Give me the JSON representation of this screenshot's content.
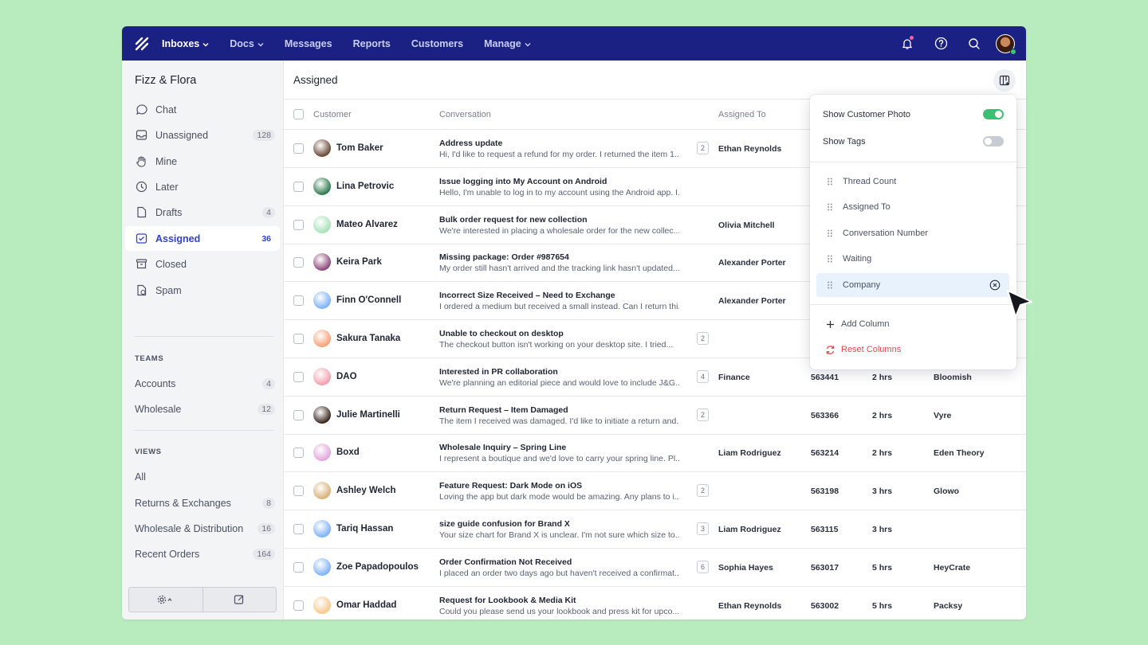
{
  "nav": {
    "items": [
      {
        "label": "Inboxes",
        "dropdown": true
      },
      {
        "label": "Docs",
        "dropdown": true
      },
      {
        "label": "Messages",
        "dropdown": false
      },
      {
        "label": "Reports",
        "dropdown": false
      },
      {
        "label": "Customers",
        "dropdown": false
      },
      {
        "label": "Manage",
        "dropdown": true
      }
    ]
  },
  "sidebar": {
    "brand": "Fizz & Flora",
    "mailboxes": [
      {
        "label": "Chat",
        "icon": "chat-bubble-icon",
        "count": ""
      },
      {
        "label": "Unassigned",
        "icon": "inbox-icon",
        "count": "128"
      },
      {
        "label": "Mine",
        "icon": "hand-icon",
        "count": ""
      },
      {
        "label": "Later",
        "icon": "clock-icon",
        "count": ""
      },
      {
        "label": "Drafts",
        "icon": "draft-icon",
        "count": "4"
      },
      {
        "label": "Assigned",
        "icon": "assigned-inbox-icon",
        "count": "36",
        "active": true
      },
      {
        "label": "Closed",
        "icon": "archive-icon",
        "count": ""
      },
      {
        "label": "Spam",
        "icon": "spam-icon",
        "count": ""
      }
    ],
    "teams_label": "TEAMS",
    "teams": [
      {
        "label": "Accounts",
        "count": "4"
      },
      {
        "label": "Wholesale",
        "count": "12"
      }
    ],
    "views_label": "VIEWS",
    "views": [
      {
        "label": "All",
        "count": ""
      },
      {
        "label": "Returns & Exchanges",
        "count": "8"
      },
      {
        "label": "Wholesale & Distribution",
        "count": "16"
      },
      {
        "label": "Recent Orders",
        "count": "164"
      }
    ]
  },
  "main": {
    "title": "Assigned",
    "columns": {
      "customer": "Customer",
      "conversation": "Conversation",
      "assigned_to": "Assigned To"
    },
    "rows": [
      {
        "customer": "Tom Baker",
        "avatar": "#6b4a3a",
        "subject": "Address update",
        "preview": "Hi, I'd like to request a refund for my order. I returned the item 1...",
        "threads": "2",
        "assigned": "Ethan Reynolds",
        "number": "",
        "waiting": "",
        "company": ""
      },
      {
        "customer": "Lina Petrovic",
        "avatar": "#2f7a52",
        "subject": "Issue logging into My Account on Android",
        "preview": "Hello, I'm unable to log in to my account using the Android app. I...",
        "threads": "",
        "assigned": "",
        "number": "",
        "waiting": "",
        "company": ""
      },
      {
        "customer": "Mateo Alvarez",
        "avatar": "#a7e2b8",
        "subject": "Bulk order request for new collection",
        "preview": "We're interested in placing a wholesale order for the new collec...",
        "threads": "",
        "assigned": "Olivia Mitchell",
        "number": "",
        "waiting": "",
        "company": ""
      },
      {
        "customer": "Keira Park",
        "avatar": "#8e4a7a",
        "subject": "Missing package: Order #987654",
        "preview": "My order still hasn't arrived and the tracking link hasn't updated...",
        "threads": "",
        "assigned": "Alexander Porter",
        "number": "",
        "waiting": "",
        "company": ""
      },
      {
        "customer": "Finn O'Connell",
        "avatar": "#7fb3f5",
        "subject": "Incorrect Size Received – Need to Exchange",
        "preview": "I ordered a medium but received a small instead. Can I return thi...",
        "threads": "",
        "assigned": "Alexander Porter",
        "number": "",
        "waiting": "",
        "company": ""
      },
      {
        "customer": "Sakura Tanaka",
        "avatar": "#f7a27a",
        "subject": "Unable to checkout on desktop",
        "preview": "The checkout button isn't working on your desktop site. I tried...",
        "threads": "2",
        "assigned": "",
        "number": "",
        "waiting": "",
        "company": ""
      },
      {
        "customer": "DAO",
        "avatar": "#f3a0b0",
        "subject": "Interested in PR collaboration",
        "preview": "We're planning an editorial piece and would love to include J&G...",
        "threads": "4",
        "assigned": "Finance",
        "number": "563441",
        "waiting": "2 hrs",
        "company": "Bloomish"
      },
      {
        "customer": "Julie Martinelli",
        "avatar": "#3b2a22",
        "subject": "Return Request – Item Damaged",
        "preview": "The item I received was damaged. I'd like to initiate a return and...",
        "threads": "2",
        "assigned": "",
        "number": "563366",
        "waiting": "2 hrs",
        "company": "Vyre"
      },
      {
        "customer": "Boxd",
        "avatar": "#e3a6dc",
        "subject": "Wholesale Inquiry – Spring Line",
        "preview": "I represent a boutique and we'd love to carry your spring line. Pl...",
        "threads": "",
        "assigned": "Liam Rodriguez",
        "number": "563214",
        "waiting": "2 hrs",
        "company": "Eden Theory"
      },
      {
        "customer": "Ashley Welch",
        "avatar": "#d8b27a",
        "subject": "Feature Request: Dark Mode on iOS",
        "preview": "Loving the app but dark mode would be amazing. Any plans to i...",
        "threads": "2",
        "assigned": "",
        "number": "563198",
        "waiting": "3 hrs",
        "company": "Glowo"
      },
      {
        "customer": "Tariq Hassan",
        "avatar": "#7fb3f5",
        "subject": "size guide confusion for Brand X",
        "preview": "Your size chart for Brand X is unclear. I'm not sure which size to...",
        "threads": "3",
        "assigned": "Liam Rodriguez",
        "number": "563115",
        "waiting": "3 hrs",
        "company": ""
      },
      {
        "customer": "Zoe Papadopoulos",
        "avatar": "#7fb3f5",
        "subject": "Order Confirmation Not Received",
        "preview": "I placed an order two days ago but haven't received a confirmat...",
        "threads": "6",
        "assigned": "Sophia Hayes",
        "number": "563017",
        "waiting": "5 hrs",
        "company": "HeyCrate"
      },
      {
        "customer": "Omar Haddad",
        "avatar": "#f7c98f",
        "subject": "Request for Lookbook & Media Kit",
        "preview": "Could you please send us your lookbook and press kit for upco...",
        "threads": "",
        "assigned": "Ethan Reynolds",
        "number": "563002",
        "waiting": "5 hrs",
        "company": "Packsy"
      }
    ]
  },
  "popover": {
    "show_photo_label": "Show Customer Photo",
    "show_photo": true,
    "show_tags_label": "Show Tags",
    "show_tags": false,
    "columns": [
      {
        "label": "Thread Count",
        "highlighted": false
      },
      {
        "label": "Assigned To",
        "highlighted": false
      },
      {
        "label": "Conversation Number",
        "highlighted": false
      },
      {
        "label": "Waiting",
        "highlighted": false
      },
      {
        "label": "Company",
        "highlighted": true
      }
    ],
    "add_column": "Add Column",
    "reset_columns": "Reset Columns"
  },
  "colors": {
    "topbar": "#1b2183",
    "accent": "#2e43c7",
    "toggle_on": "#3fbf74",
    "reset": "#e5484d",
    "background": "#b8ebbe"
  }
}
